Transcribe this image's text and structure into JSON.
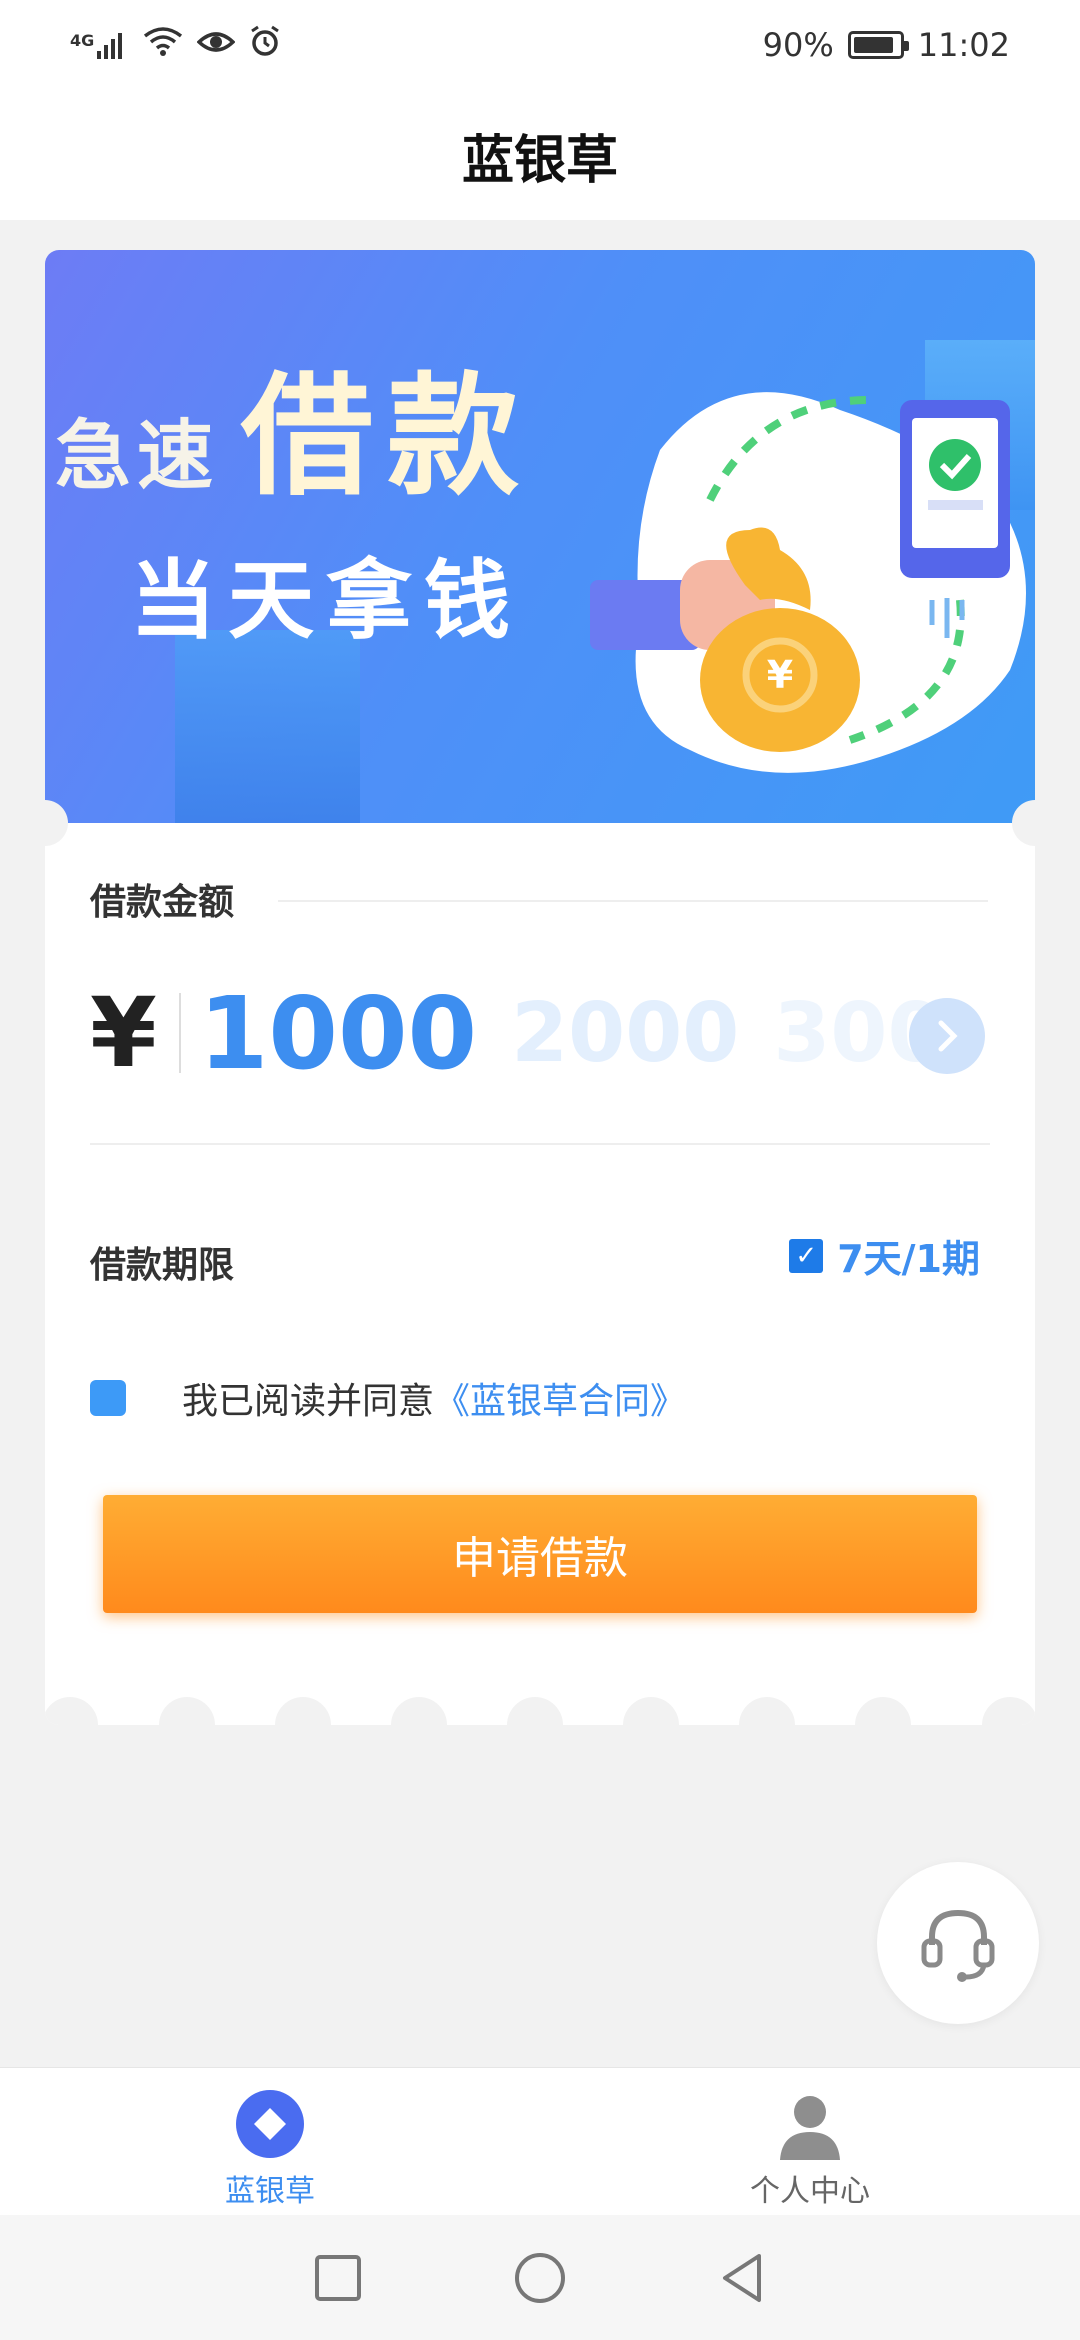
{
  "status_bar": {
    "network": "4G",
    "battery": "90%",
    "battery_level": 0.9,
    "time": "11:02"
  },
  "header": {
    "title": "蓝银草"
  },
  "banner": {
    "line1_small": "急速",
    "line1_big": "借款",
    "line2": "当天拿钱",
    "coin_symbol": "¥"
  },
  "loan": {
    "amount_label": "借款金额",
    "currency": "¥",
    "amounts": [
      "1000",
      "2000",
      "3000"
    ],
    "selected_amount": "1000",
    "next_icon": "chevron-right-icon",
    "term_label": "借款期限",
    "term_value": "7天/1期",
    "agree_text": "我已阅读并同意",
    "contract_link": "《蓝银草合同》",
    "apply_button": "申请借款"
  },
  "tabs": [
    {
      "label": "蓝银草",
      "icon": "diamond-home-icon",
      "active": true
    },
    {
      "label": "个人中心",
      "icon": "person-icon",
      "active": false
    }
  ],
  "colors": {
    "accent": "#3d8ef0",
    "button_top": "#ffad34",
    "button_bottom": "#ff8a1c"
  }
}
